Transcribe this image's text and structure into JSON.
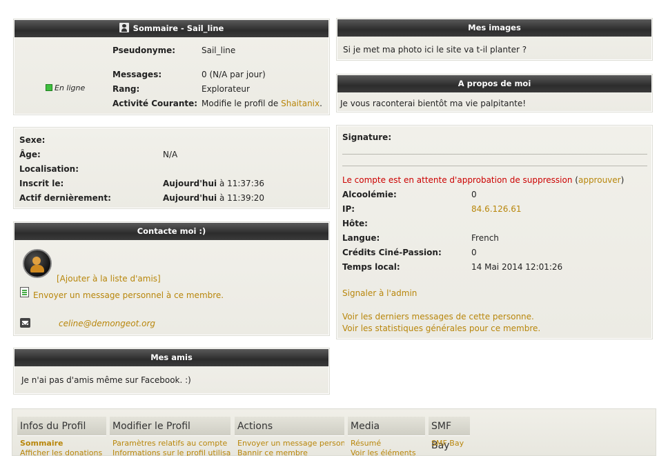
{
  "summary": {
    "title": "Sommaire - Sail_line",
    "status": "En ligne",
    "pseudonyme_label": "Pseudonyme:",
    "pseudonyme": "Sail_line",
    "messages_label": "Messages:",
    "messages": "0 (N/A par jour)",
    "rang_label": "Rang:",
    "rang": "Explorateur",
    "activite_label": "Activité Courante:",
    "activite_prefix": "Modifie le profil de ",
    "activite_user": "Shaitanix",
    "activite_suffix": "."
  },
  "details": {
    "sexe_label": "Sexe:",
    "age_label": "Âge:",
    "age": "N/A",
    "localisation_label": "Localisation:",
    "inscrit_label": "Inscrit le:",
    "inscrit_day": "Aujourd'hui",
    "inscrit_time": " à 11:37:36",
    "actif_label": "Actif dernièrement:",
    "actif_day": "Aujourd'hui",
    "actif_time": " à 11:39:20"
  },
  "contact": {
    "title": "Contacte moi :)",
    "add_friend": "[Ajouter à la liste d'amis]",
    "send_pm": "Envoyer un message personnel à ce membre.",
    "email": "celine@demongeot.org"
  },
  "friends": {
    "title": "Mes amis",
    "text": "Je n'ai pas d'amis même sur Facebook. :)"
  },
  "images": {
    "title": "Mes images",
    "text": "Si je met ma photo ici le site va t-il planter ?"
  },
  "about": {
    "title": "A propos de moi",
    "text": "Je vous raconterai bientôt ma vie palpitante!"
  },
  "signature": {
    "label": "Signature:",
    "pending_text": "Le compte est en attente d'approbation de suppression",
    "paren_open": " (",
    "approve": "approuver",
    "paren_close": ")",
    "alcool_label": "Alcoolémie:",
    "alcool": "0",
    "ip_label": "IP:",
    "ip": "84.6.126.61",
    "hote_label": "Hôte:",
    "langue_label": "Langue:",
    "langue": "French",
    "credits_label": "Crédits Ciné-Passion:",
    "credits": "0",
    "temps_label": "Temps local:",
    "temps": "14 Mai 2014 12:01:26",
    "report": "Signaler à l'admin",
    "last_messages": "Voir les derniers messages de cette personne.",
    "stats": "Voir les statistiques générales pour ce membre."
  },
  "menu": {
    "cols": [
      {
        "title": "Infos du Profil",
        "items": [
          "Sommaire",
          "Afficher les donations"
        ]
      },
      {
        "title": "Modifier le Profil",
        "items": [
          "Paramètres relatifs au compte",
          "Informations sur le profil utilisateur"
        ]
      },
      {
        "title": "Actions",
        "items": [
          "Envoyer un message personnel",
          "Bannir ce membre"
        ]
      },
      {
        "title": "Media",
        "items": [
          "Résumé",
          "Voir les éléments"
        ]
      },
      {
        "title": "SMF Bay",
        "items": [
          "SMF Bay"
        ]
      }
    ]
  },
  "colors": {
    "link": "#b8860b",
    "alert": "#cc0000",
    "online": "#3fbf3f"
  }
}
